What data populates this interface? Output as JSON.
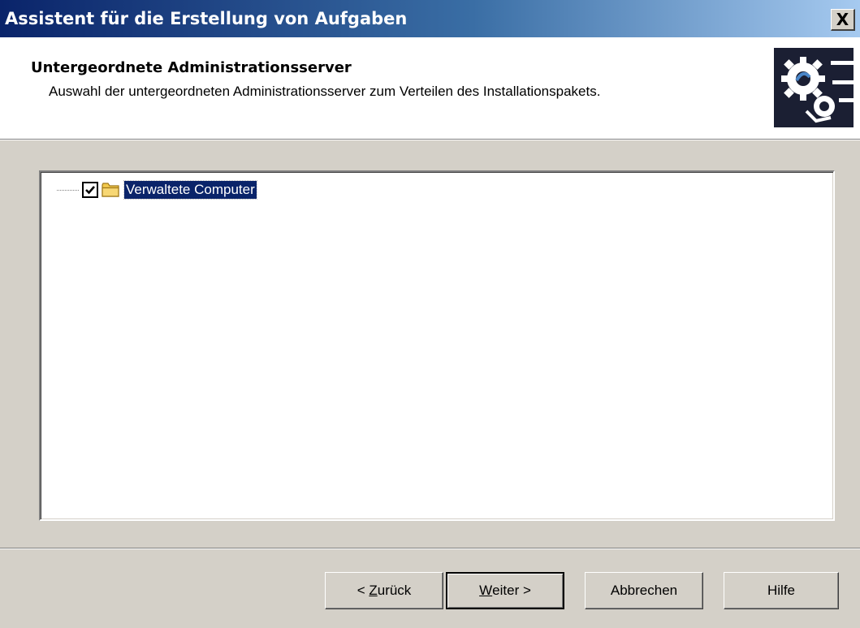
{
  "window": {
    "title": "Assistent für die Erstellung von Aufgaben",
    "close_symbol": "X"
  },
  "header": {
    "title": "Untergeordnete Administrationsserver",
    "subtitle": "Auswahl der untergeordneten Administrationsserver zum Verteilen des Installationspakets.",
    "icon": "gears-wizard-icon"
  },
  "tree": {
    "items": [
      {
        "label": "Verwaltete Computer",
        "checked": true,
        "selected": true,
        "icon": "folder-icon"
      }
    ]
  },
  "buttons": {
    "back": {
      "prefix": "< ",
      "mnemonic": "Z",
      "rest": "urück"
    },
    "next": {
      "mnemonic": "W",
      "rest": "eiter >"
    },
    "cancel": "Abbrechen",
    "help": "Hilfe"
  },
  "colors": {
    "title_gradient_start": "#0a246a",
    "title_gradient_end": "#a6caf0",
    "dialog_background": "#d4d0c8",
    "selection": "#0a246a"
  }
}
